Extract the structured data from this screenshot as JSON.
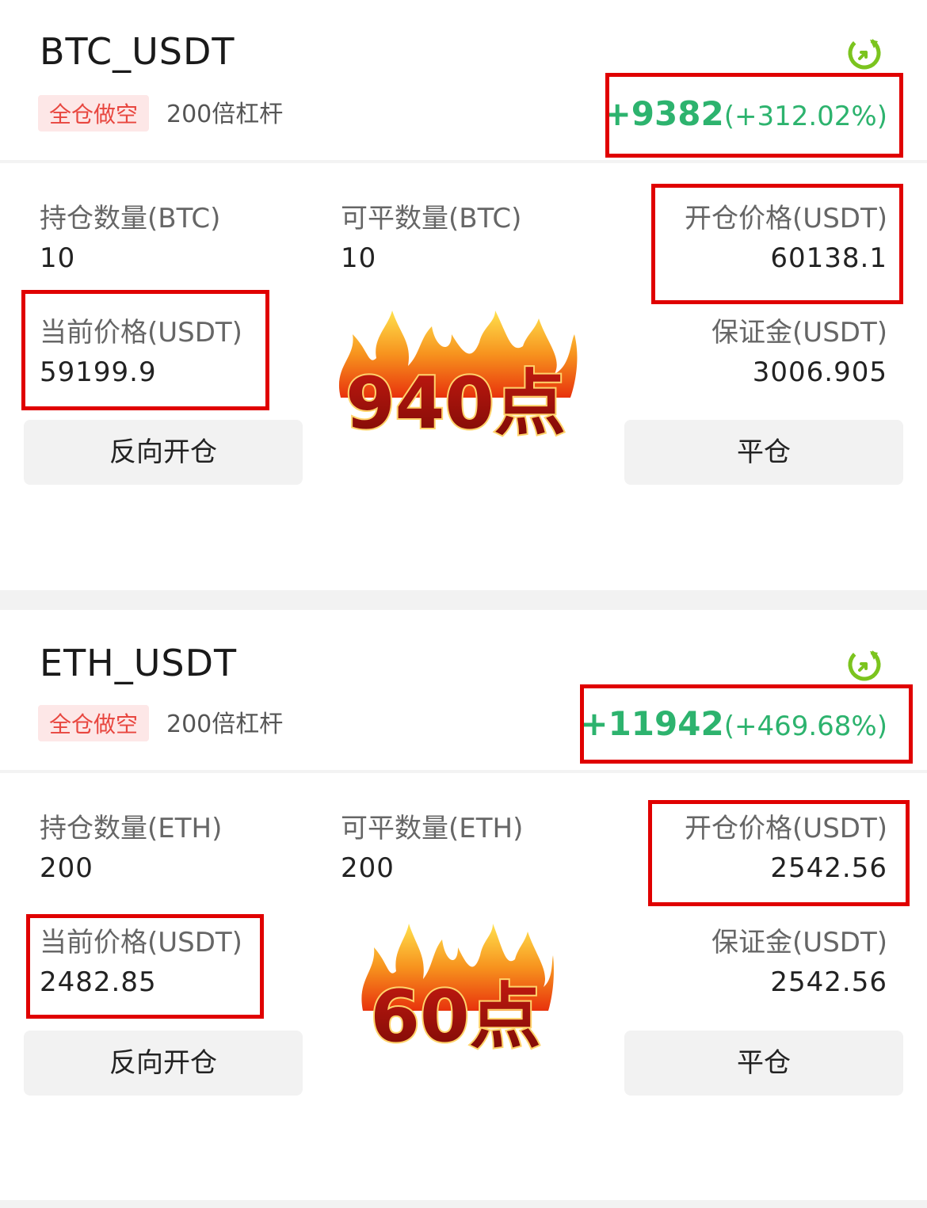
{
  "positions": [
    {
      "symbol": "BTC_USDT",
      "mode_tag": "全仓做空",
      "leverage": "200倍杠杆",
      "pnl_amount": "+9382",
      "pnl_percent": "(+312.02%)",
      "hold_qty_label": "持仓数量(BTC)",
      "hold_qty_value": "10",
      "closable_qty_label": "可平数量(BTC)",
      "closable_qty_value": "10",
      "open_price_label": "开仓价格(USDT)",
      "open_price_value": "60138.1",
      "current_price_label": "当前价格(USDT)",
      "current_price_value": "59199.9",
      "margin_label": "保证金(USDT)",
      "margin_value": "3006.905",
      "reverse_button": "反向开仓",
      "close_button": "平仓",
      "badge": "940点"
    },
    {
      "symbol": "ETH_USDT",
      "mode_tag": "全仓做空",
      "leverage": "200倍杠杆",
      "pnl_amount": "+11942",
      "pnl_percent": "(+469.68%)",
      "hold_qty_label": "持仓数量(ETH)",
      "hold_qty_value": "200",
      "closable_qty_label": "可平数量(ETH)",
      "closable_qty_value": "200",
      "open_price_label": "开仓价格(USDT)",
      "open_price_value": "2542.56",
      "current_price_label": "当前价格(USDT)",
      "current_price_value": "2482.85",
      "margin_label": "保证金(USDT)",
      "margin_value": "2542.56",
      "reverse_button": "反向开仓",
      "close_button": "平仓",
      "badge": "60点"
    }
  ],
  "colors": {
    "profit_green": "#2db36e",
    "tag_red": "#e8463f",
    "tag_bg": "#fde7e7",
    "highlight_box": "#e00000",
    "refresh_icon": "#7bc41e"
  },
  "icons": {
    "refresh": "refresh-icon",
    "fire_badge": "fire-icon"
  }
}
